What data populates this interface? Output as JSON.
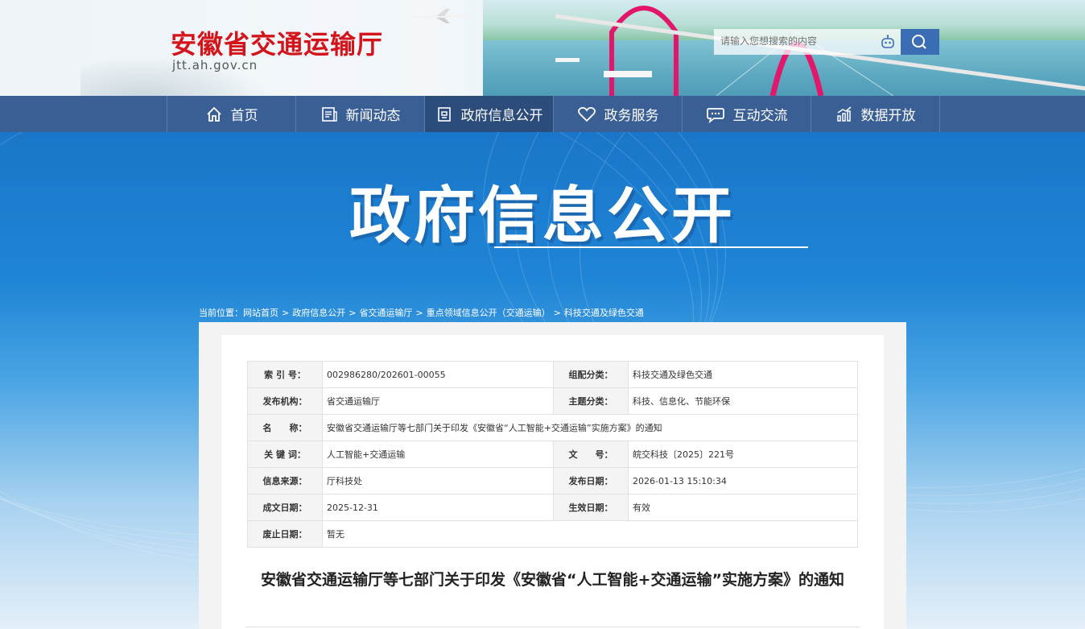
{
  "header": {
    "site_title": "安徽省交通运输厅",
    "site_url": "jtt.ah.gov.cn",
    "search_placeholder": "请输入您想搜索的内容"
  },
  "nav": [
    {
      "label": "首页",
      "icon": "home-icon"
    },
    {
      "label": "新闻动态",
      "icon": "news-icon"
    },
    {
      "label": "政府信息公开",
      "icon": "document-icon",
      "active": true
    },
    {
      "label": "政务服务",
      "icon": "heart-icon"
    },
    {
      "label": "互动交流",
      "icon": "chat-icon"
    },
    {
      "label": "数据开放",
      "icon": "chart-icon"
    }
  ],
  "banner": {
    "title": "政府信息公开"
  },
  "breadcrumb": {
    "prefix": "当前位置：",
    "items": [
      "网站首页",
      "政府信息公开",
      "省交通运输厅",
      "重点领域信息公开（交通运输）",
      "科技交通及绿色交通"
    ],
    "separator": ">"
  },
  "meta": [
    {
      "k1": "索 引 号：",
      "v1": "002986280/202601-00055",
      "k2": "组配分类：",
      "v2": "科技交通及绿色交通"
    },
    {
      "k1": "发布机构：",
      "v1": "省交通运输厅",
      "k2": "主题分类：",
      "v2": "科技、信息化、节能环保"
    },
    {
      "k1": "名　　称：",
      "v1": "安徽省交通运输厅等七部门关于印发《安徽省“人工智能+交通运输”实施方案》的通知"
    },
    {
      "k1": "关 键 词：",
      "v1": "人工智能+交通运输",
      "k2": "文　　号：",
      "v2": "皖交科技〔2025〕221号"
    },
    {
      "k1": "信息来源：",
      "v1": "厅科技处",
      "k2": "发布日期：",
      "v2": "2026-01-13 15:10:34"
    },
    {
      "k1": "成文日期：",
      "v1": "2025-12-31",
      "k2": "生效日期：",
      "v2": "有效"
    },
    {
      "k1": "废止日期：",
      "v1": "暂无"
    }
  ],
  "document": {
    "title": "安徽省交通运输厅等七部门关于印发《安徽省“人工智能+交通运输”实施方案》的通知"
  },
  "colors": {
    "brand_red": "#d4141b",
    "nav_blue": "#3a5f94",
    "accent_blue": "#3b6db5"
  }
}
